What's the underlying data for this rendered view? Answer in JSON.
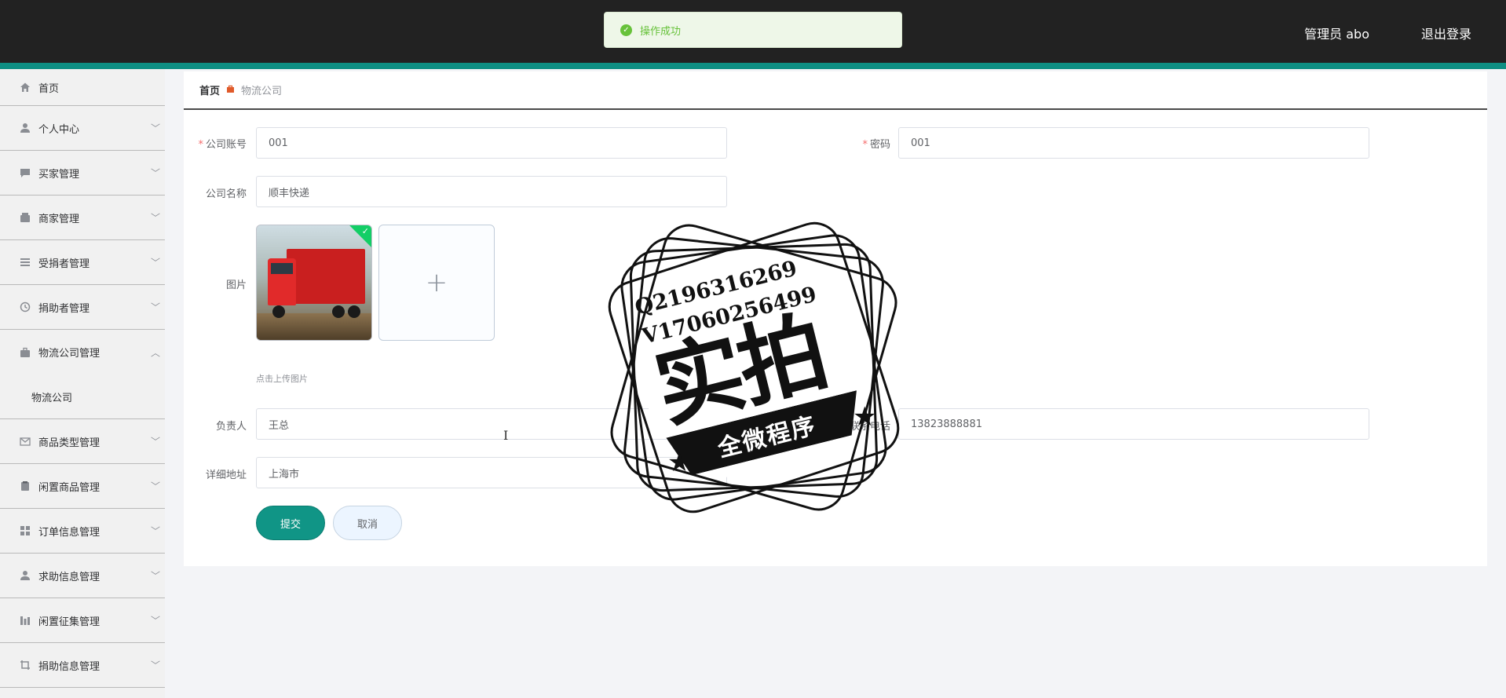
{
  "header": {
    "user_label": "管理员 abo",
    "logout_label": "退出登录"
  },
  "toast": {
    "icon": "check-circle-icon",
    "message": "操作成功",
    "color": "#67c23a"
  },
  "sidebar": {
    "items": [
      {
        "label": "首页",
        "icon": "home-icon"
      },
      {
        "label": "个人中心",
        "icon": "user-icon"
      },
      {
        "label": "买家管理",
        "icon": "message-icon"
      },
      {
        "label": "商家管理",
        "icon": "wallet-icon"
      },
      {
        "label": "受捐者管理",
        "icon": "list-icon"
      },
      {
        "label": "捐助者管理",
        "icon": "clock-icon"
      },
      {
        "label": "物流公司管理",
        "icon": "briefcase-icon",
        "expanded": true
      },
      {
        "label": "商品类型管理",
        "icon": "mail-icon"
      },
      {
        "label": "闲置商品管理",
        "icon": "clipboard-icon"
      },
      {
        "label": "订单信息管理",
        "icon": "grid-icon"
      },
      {
        "label": "求助信息管理",
        "icon": "user-icon"
      },
      {
        "label": "闲置征集管理",
        "icon": "chart-icon"
      },
      {
        "label": "捐助信息管理",
        "icon": "crop-icon"
      }
    ],
    "submenu": [
      {
        "label": "物流公司"
      }
    ]
  },
  "breadcrumb": {
    "home": "首页",
    "current": "物流公司"
  },
  "form": {
    "account_label": "公司账号",
    "account_value": "001",
    "password_label": "密码",
    "password_value": "001",
    "name_label": "公司名称",
    "name_value": "顺丰快递",
    "image_label": "图片",
    "upload_tip": "点击上传图片",
    "contact_label": "负责人",
    "contact_value": "王总",
    "phone_label": "联系电话",
    "phone_value": "13823888881",
    "address_label": "详细地址",
    "address_value": "上海市",
    "submit_label": "提交",
    "cancel_label": "取消"
  },
  "watermark": {
    "line1": "Q2196316269",
    "line2": "V17060256499",
    "big": "实拍",
    "ribbon": "全微程序"
  },
  "colors": {
    "accent": "#109586",
    "topbar": "#222222",
    "required": "#f56c6c"
  }
}
